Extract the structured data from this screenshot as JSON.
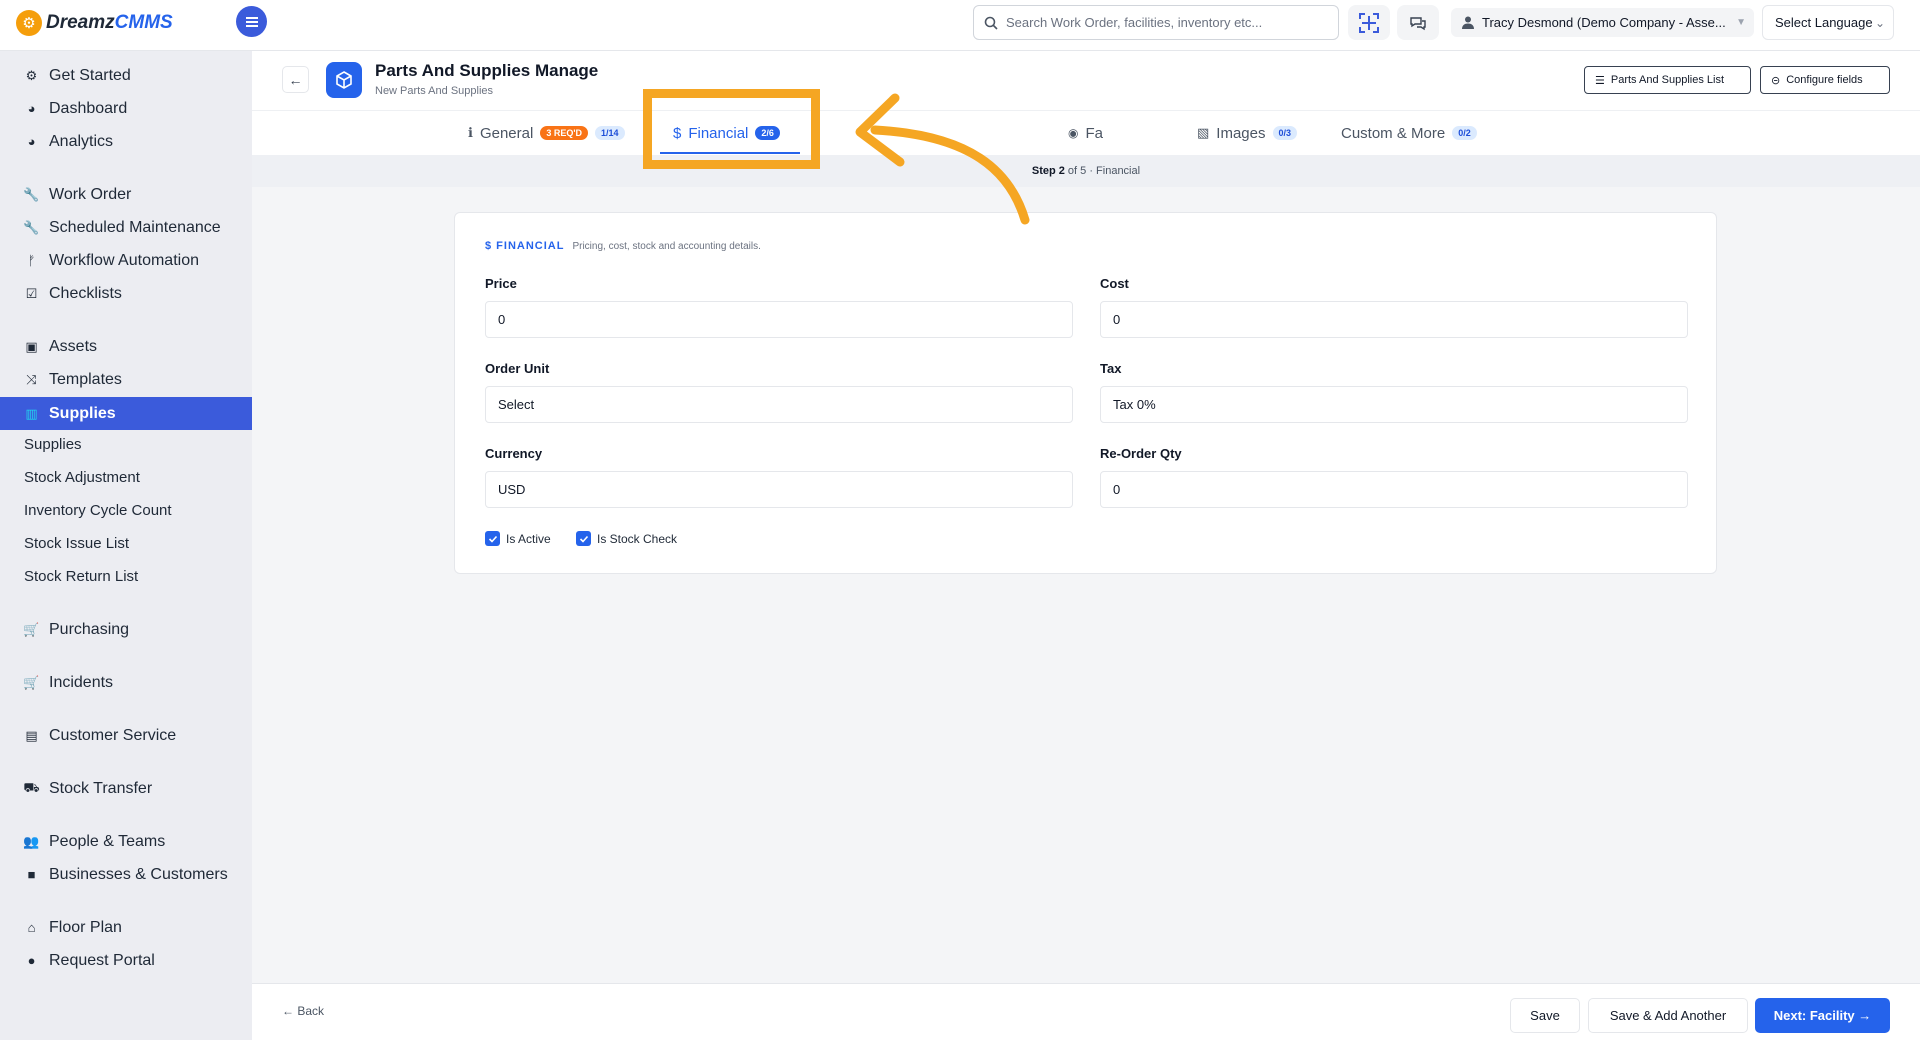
{
  "app": {
    "logo_main": "Dreamz",
    "logo_accent": "CMMS",
    "search_placeholder": "Search Work Order, facilities, inventory etc...",
    "user_label": "Tracy Desmond (Demo Company - Asse...",
    "language_label": "Select Language"
  },
  "sidebar": {
    "items": [
      {
        "label": "Get Started",
        "icon": "gears-icon"
      },
      {
        "label": "Dashboard",
        "icon": "dashboard-icon"
      },
      {
        "label": "Analytics",
        "icon": "analytics-icon"
      },
      {
        "label": "Work Order",
        "icon": "wrench-icon"
      },
      {
        "label": "Scheduled Maintenance",
        "icon": "wrench-icon"
      },
      {
        "label": "Workflow Automation",
        "icon": "workflow-icon"
      },
      {
        "label": "Checklists",
        "icon": "checkbox-icon"
      },
      {
        "label": "Assets",
        "icon": "archive-icon"
      },
      {
        "label": "Templates",
        "icon": "shuffle-icon"
      },
      {
        "label": "Supplies",
        "icon": "supplies-icon"
      },
      {
        "label": "Purchasing",
        "icon": "cart-icon"
      },
      {
        "label": "Incidents",
        "icon": "cart-icon"
      },
      {
        "label": "Customer Service",
        "icon": "document-icon"
      },
      {
        "label": "Stock Transfer",
        "icon": "truck-icon"
      },
      {
        "label": "People & Teams",
        "icon": "people-icon"
      },
      {
        "label": "Businesses & Customers",
        "icon": "video-icon"
      },
      {
        "label": "Floor Plan",
        "icon": "floorplan-icon"
      },
      {
        "label": "Request Portal",
        "icon": "chat-icon"
      }
    ],
    "subitems": [
      "Supplies",
      "Stock Adjustment",
      "Inventory Cycle Count",
      "Stock Issue List",
      "Stock Return List"
    ]
  },
  "page": {
    "title": "Parts And Supplies Manage",
    "subtitle": "New Parts And Supplies",
    "list_button": "Parts And Supplies List",
    "configure_button": "Configure fields"
  },
  "tabs": [
    {
      "label": "General",
      "req": "3 REQ'D",
      "count": "1/14"
    },
    {
      "label": "Financial",
      "count": "2/6"
    },
    {
      "label": "Fa"
    },
    {
      "label": "Images",
      "count": "0/3"
    },
    {
      "label": "Custom & More",
      "count": "0/2"
    }
  ],
  "step": {
    "prefix": "Step 2",
    "rest": "of 5 · Financial"
  },
  "section": {
    "title": "$ FINANCIAL",
    "desc": "Pricing, cost, stock and accounting details."
  },
  "fields": {
    "price": {
      "label": "Price",
      "value": "0"
    },
    "cost": {
      "label": "Cost",
      "value": "0"
    },
    "order_unit": {
      "label": "Order Unit",
      "value": "Select"
    },
    "tax": {
      "label": "Tax",
      "value": "Tax 0%"
    },
    "currency": {
      "label": "Currency",
      "value": "USD"
    },
    "reorder_qty": {
      "label": "Re-Order Qty",
      "value": "0"
    }
  },
  "checks": {
    "is_active": "Is Active",
    "is_stock_check": "Is Stock Check"
  },
  "footer": {
    "back": "← Back",
    "save": "Save",
    "save_add": "Save & Add Another",
    "next": "Next: Facility →"
  },
  "colors": {
    "accent": "#2563eb",
    "highlight": "#f5a623",
    "sidebar_active": "#3b5bdb"
  }
}
